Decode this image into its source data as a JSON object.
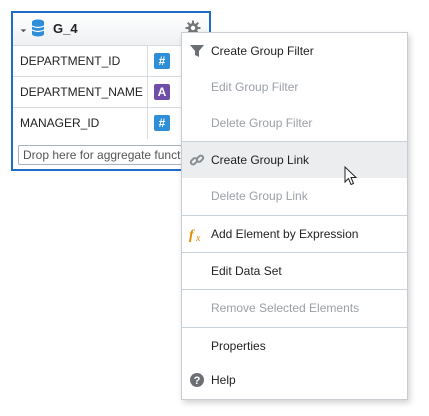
{
  "group": {
    "title": "G_4",
    "icons": {
      "collapse": "collapse-triangle-icon",
      "database": "database-icon",
      "settings": "gear-icon"
    },
    "fields": [
      {
        "name": "DEPARTMENT_ID",
        "type_glyph": "#",
        "type_icon": "number-type-icon"
      },
      {
        "name": "DEPARTMENT_NAME",
        "type_glyph": "A",
        "type_icon": "text-type-icon"
      },
      {
        "name": "MANAGER_ID",
        "type_glyph": "#",
        "type_icon": "number-type-icon"
      }
    ],
    "drop_placeholder": "Drop here for aggregate functions"
  },
  "menu": {
    "items": [
      {
        "label": "Create Group Filter",
        "enabled": true,
        "icon": "filter-icon"
      },
      {
        "label": "Edit Group Filter",
        "enabled": false
      },
      {
        "label": "Delete Group Filter",
        "enabled": false
      },
      {
        "label": "Create Group Link",
        "enabled": true,
        "icon": "link-icon",
        "hovered": true
      },
      {
        "label": "Delete Group Link",
        "enabled": false
      },
      {
        "label": "Add Element by Expression",
        "enabled": true,
        "icon": "function-fx-icon"
      },
      {
        "label": "Edit Data Set",
        "enabled": true
      },
      {
        "label": "Remove Selected Elements",
        "enabled": false
      },
      {
        "label": "Properties",
        "enabled": true
      },
      {
        "label": "Help",
        "enabled": true,
        "icon": "help-icon"
      }
    ]
  },
  "colors": {
    "selection_border": "#1f6dc4",
    "number_badge": "#2e8fd8",
    "text_badge": "#6e4ea6",
    "fx_icon": "#e08a00",
    "hover_bg": "#ebedef",
    "disabled_text": "#9aa0a6"
  }
}
